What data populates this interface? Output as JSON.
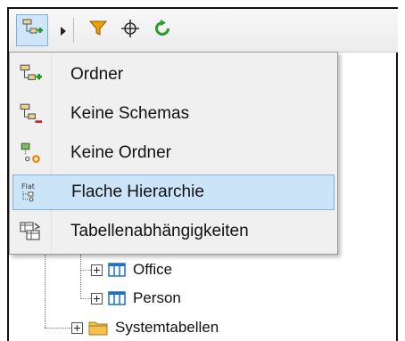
{
  "toolbar": {
    "buttons": [
      {
        "name": "add-folder-dropdown-button",
        "icon": "folder-add-icon"
      },
      {
        "name": "filter-button",
        "icon": "funnel-icon"
      },
      {
        "name": "locate-button",
        "icon": "crosshair-icon"
      },
      {
        "name": "refresh-button",
        "icon": "refresh-icon"
      }
    ]
  },
  "menu": {
    "items": [
      {
        "label": "Ordner",
        "icon": "folder-add-icon"
      },
      {
        "label": "Keine Schemas",
        "icon": "no-schemas-icon"
      },
      {
        "label": "Keine Ordner",
        "icon": "no-folders-icon"
      },
      {
        "label": "Flache Hierarchie",
        "icon": "flat-hierarchy-icon",
        "highlighted": true
      },
      {
        "label": "Tabellenabhängigkeiten",
        "icon": "table-dependencies-icon"
      }
    ]
  },
  "tree": {
    "items": [
      {
        "label": "Office",
        "icon": "table-icon"
      },
      {
        "label": "Person",
        "icon": "table-icon"
      },
      {
        "label": "Systemtabellen",
        "icon": "folder-icon"
      }
    ]
  },
  "colors": {
    "highlight_bg": "#cce4f7",
    "highlight_border": "#7fb0dd",
    "menu_bg": "#f0f0f0",
    "table_icon_blue": "#1f6fd1",
    "folder_yellow": "#f2c14e",
    "filter_orange": "#f0a000",
    "refresh_green": "#2a9a2a"
  }
}
